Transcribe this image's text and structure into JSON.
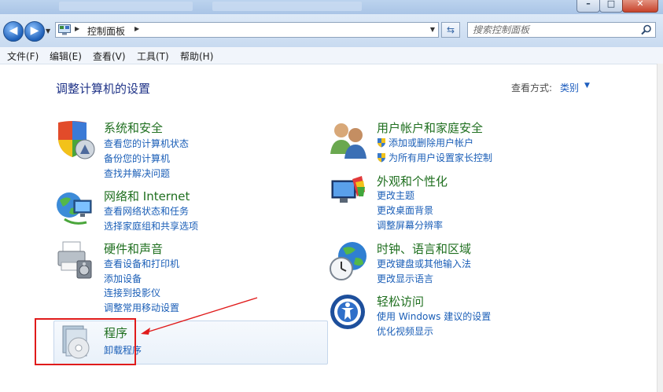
{
  "address_bar": {
    "path": [
      "控制面板"
    ],
    "search_placeholder": "搜索控制面板"
  },
  "menu": {
    "items": [
      "文件(F)",
      "编辑(E)",
      "查看(V)",
      "工具(T)",
      "帮助(H)"
    ]
  },
  "content": {
    "heading": "调整计算机的设置",
    "view_by_label": "查看方式:",
    "view_by_value": "类别"
  },
  "categories": {
    "system_security": {
      "title": "系统和安全",
      "links": [
        "查看您的计算机状态",
        "备份您的计算机",
        "查找并解决问题"
      ]
    },
    "network": {
      "title": "网络和 Internet",
      "links": [
        "查看网络状态和任务",
        "选择家庭组和共享选项"
      ]
    },
    "hardware": {
      "title": "硬件和声音",
      "links": [
        "查看设备和打印机",
        "添加设备",
        "连接到投影仪",
        "调整常用移动设置"
      ]
    },
    "programs": {
      "title": "程序",
      "links": [
        "卸载程序"
      ]
    },
    "user_accounts": {
      "title": "用户帐户和家庭安全",
      "links": [
        "添加或删除用户帐户",
        "为所有用户设置家长控制"
      ]
    },
    "appearance": {
      "title": "外观和个性化",
      "links": [
        "更改主题",
        "更改桌面背景",
        "调整屏幕分辨率"
      ]
    },
    "clock_region": {
      "title": "时钟、语言和区域",
      "links": [
        "更改键盘或其他输入法",
        "更改显示语言"
      ]
    },
    "ease_access": {
      "title": "轻松访问",
      "links": [
        "使用 Windows 建议的设置",
        "优化视频显示"
      ]
    }
  },
  "colors": {
    "category_title": "#1f6f1f",
    "link": "#1a5eb7",
    "heading": "#1e3287",
    "annotation": "#e01b1b"
  }
}
